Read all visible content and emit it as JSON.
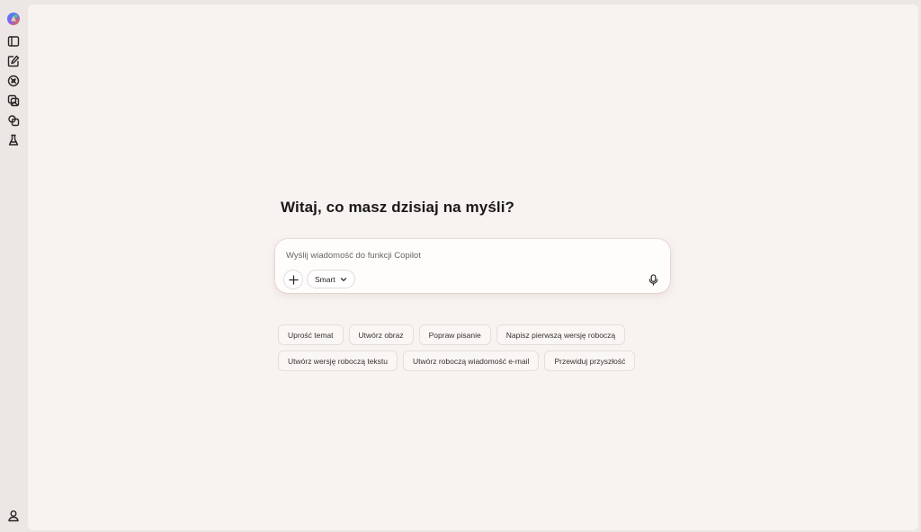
{
  "sidebar": {
    "items": [
      {
        "icon": "copilot-logo-icon"
      },
      {
        "icon": "sidebar-toggle-icon"
      },
      {
        "icon": "new-chat-icon"
      },
      {
        "icon": "discover-icon"
      },
      {
        "icon": "images-icon"
      },
      {
        "icon": "pages-icon"
      },
      {
        "icon": "labs-icon"
      }
    ],
    "bottom_icon": "profile-icon"
  },
  "main": {
    "greeting": "Witaj, co masz dzisiaj na myśli?",
    "composer": {
      "placeholder": "Wyślij wiadomość do funkcji Copilot",
      "value": "",
      "mode_label": "Smart"
    },
    "suggestions": [
      [
        "Uprość temat",
        "Utwórz obraz",
        "Popraw pisanie",
        "Napisz pierwszą wersję roboczą"
      ],
      [
        "Utwórz wersję roboczą tekstu",
        "Utwórz roboczą wiadomość e-mail",
        "Przewiduj przyszłość"
      ]
    ]
  },
  "colors": {
    "app_background": "#ece6e4",
    "panel_background": "#f7f3f1",
    "composer_background": "#fefdfc",
    "text_primary": "#1c1817",
    "text_placeholder": "#6d6462"
  }
}
